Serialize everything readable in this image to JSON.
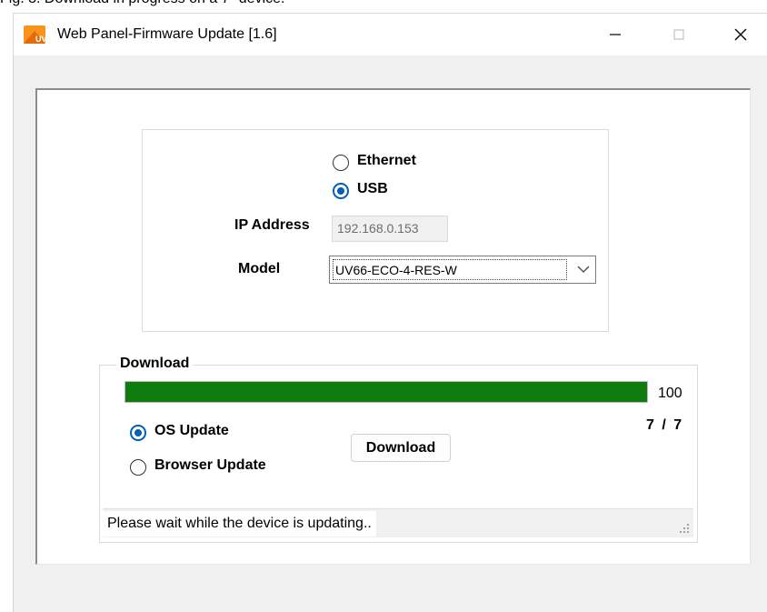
{
  "caption": "Fig. 3: Download in progress on a 7\" device.",
  "window": {
    "title": "Web Panel-Firmware Update [1.6]",
    "icon": "uv-app-icon"
  },
  "connection": {
    "options": [
      {
        "label": "Ethernet",
        "selected": false
      },
      {
        "label": "USB",
        "selected": true
      }
    ],
    "ip_label": "IP Address",
    "ip_value": "192.168.0.153",
    "model_label": "Model",
    "model_value": "UV66-ECO-4-RES-W"
  },
  "download": {
    "group_title": "Download",
    "progress_value": 100,
    "progress_text": "100",
    "counter": "7 / 7",
    "update_options": [
      {
        "label": "OS Update",
        "selected": true
      },
      {
        "label": "Browser Update",
        "selected": false
      }
    ],
    "button_label": "Download",
    "status_text": "Please wait while the device is updating.."
  },
  "colors": {
    "progress_fill": "#0f7b0f",
    "radio_selected": "#005fb8",
    "icon_orange": "#f7941d"
  }
}
